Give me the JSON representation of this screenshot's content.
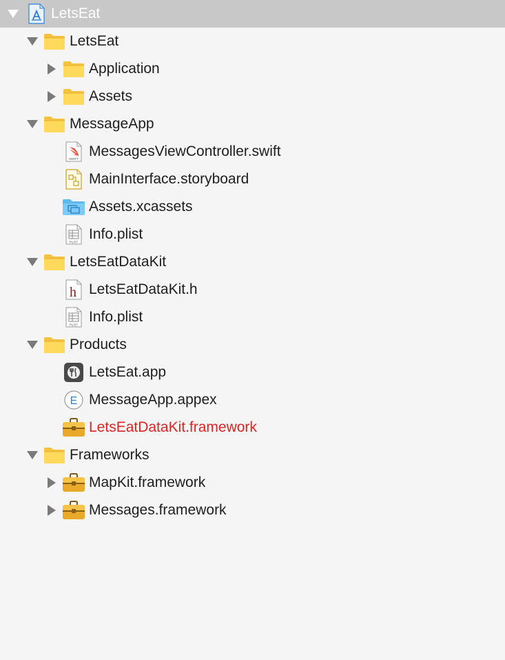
{
  "project": {
    "name": "LetsEat"
  },
  "groups": [
    {
      "name": "LetsEat",
      "children": [
        {
          "name": "Application",
          "icon": "folder-icon",
          "collapsed": true
        },
        {
          "name": "Assets",
          "icon": "folder-icon",
          "collapsed": true
        }
      ]
    },
    {
      "name": "MessageApp",
      "children": [
        {
          "name": "MessagesViewController.swift",
          "icon": "swift-file-icon",
          "badge": "SWIFT"
        },
        {
          "name": "MainInterface.storyboard",
          "icon": "storyboard-file-icon"
        },
        {
          "name": "Assets.xcassets",
          "icon": "asset-catalog-icon"
        },
        {
          "name": "Info.plist",
          "icon": "plist-file-icon",
          "badge": "PLIST"
        }
      ]
    },
    {
      "name": "LetsEatDataKit",
      "children": [
        {
          "name": "LetsEatDataKit.h",
          "icon": "header-file-icon",
          "glyph": "h"
        },
        {
          "name": "Info.plist",
          "icon": "plist-file-icon",
          "badge": "PLIST"
        }
      ]
    },
    {
      "name": "Products",
      "children": [
        {
          "name": "LetsEat.app",
          "icon": "app-product-icon"
        },
        {
          "name": "MessageApp.appex",
          "icon": "app-extension-icon",
          "glyph": "E"
        },
        {
          "name": "LetsEatDataKit.framework",
          "icon": "framework-icon",
          "missing": true,
          "missing_color": "#e02424"
        }
      ]
    },
    {
      "name": "Frameworks",
      "children": [
        {
          "name": "MapKit.framework",
          "icon": "framework-icon",
          "collapsed": true
        },
        {
          "name": "Messages.framework",
          "icon": "framework-icon",
          "collapsed": true
        }
      ]
    }
  ]
}
